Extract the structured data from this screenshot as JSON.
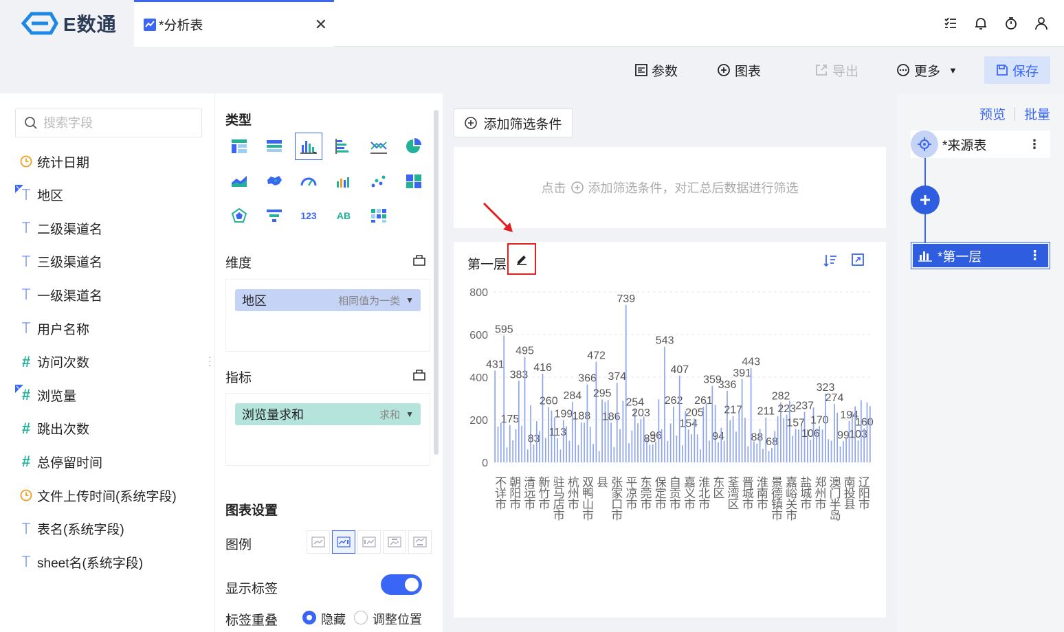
{
  "app": {
    "logo_text": "E数通",
    "tab_title": "*分析表"
  },
  "toolbar": {
    "param_label": "参数",
    "chart_label": "图表",
    "export_label": "导出",
    "more_label": "更多",
    "save_label": "保存"
  },
  "search": {
    "placeholder": "搜索字段"
  },
  "fields": [
    {
      "type": "date",
      "label": "统计日期"
    },
    {
      "type": "text-flag",
      "label": "地区"
    },
    {
      "type": "text",
      "label": "二级渠道名"
    },
    {
      "type": "text",
      "label": "三级渠道名"
    },
    {
      "type": "text",
      "label": "一级渠道名"
    },
    {
      "type": "text",
      "label": "用户名称"
    },
    {
      "type": "number",
      "label": "访问次数"
    },
    {
      "type": "number-flag",
      "label": "浏览量"
    },
    {
      "type": "number",
      "label": "跳出次数"
    },
    {
      "type": "number",
      "label": "总停留时间"
    },
    {
      "type": "date",
      "label": "文件上传时间(系统字段)"
    },
    {
      "type": "text",
      "label": "表名(系统字段)"
    },
    {
      "type": "text",
      "label": "sheet名(系统字段)"
    }
  ],
  "config": {
    "type_title": "类型",
    "dimension_title": "维度",
    "dimension_pill": {
      "label": "地区",
      "sub": "相同值为一类"
    },
    "metric_title": "指标",
    "metric_pill": {
      "label": "浏览量求和",
      "sub": "求和"
    },
    "chart_settings_title": "图表设置",
    "legend_label": "图例",
    "show_labels_label": "显示标签",
    "overlap_label": "标签重叠",
    "overlap_opt1": "隐藏",
    "overlap_opt2": "调整位置"
  },
  "filter": {
    "add_button": "添加筛选条件",
    "hint_prefix": "点击",
    "hint_suffix": "添加筛选条件，对汇总后数据进行筛选"
  },
  "chart_card": {
    "title": "第一层"
  },
  "right_panel": {
    "preview_label": "预览",
    "batch_label": "批量",
    "source_node": "*来源表",
    "layer_node": "*第一层"
  },
  "colors": {
    "accent": "#3a66f6",
    "bar": "#8fa6ec",
    "toggle": "#3a66f6",
    "highlight": "#e02020"
  },
  "chart_data": {
    "type": "bar",
    "ylim": [
      0,
      800
    ],
    "yticks": [
      0,
      200,
      400,
      600,
      800
    ],
    "categories": [
      "不详市",
      "朝阳市",
      "清远市",
      "新竹市",
      "驻马店市",
      "杭州市",
      "双鸭山市",
      "县",
      "张家口市",
      "平凉市",
      "东莞市",
      "保定市",
      "自贡市",
      "嘉义市",
      "淮北市",
      "东区",
      "荃湾区",
      "晋城市",
      "淮南市",
      "景德镇市",
      "嘉峪关市",
      "盐城市",
      "郑州市",
      "澳门半岛",
      "南投县",
      "辽阳市"
    ],
    "values": [
      431,
      595,
      175,
      383,
      495,
      83,
      416,
      260,
      113,
      199,
      284,
      188,
      366,
      472,
      295,
      186,
      374,
      739,
      254,
      203,
      83,
      96,
      543,
      262,
      407,
      154,
      205,
      261,
      359,
      94,
      336,
      217,
      391,
      443,
      88,
      211,
      68,
      282,
      223,
      157,
      237,
      106,
      170,
      323,
      274,
      99,
      194,
      103,
      160
    ],
    "bar_count": 127,
    "series": [
      {
        "name": "浏览量求和"
      }
    ]
  }
}
